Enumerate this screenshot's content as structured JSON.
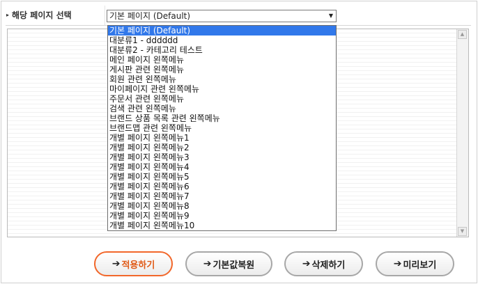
{
  "field": {
    "label": "해당 페이지 선택",
    "selected_value": "기본 페이지 (Default)",
    "options": [
      "기본 페이지 (Default)",
      "대분류1 - dddddd",
      "대분류2 - 카테고리 테스트",
      "메인 페이지 왼쪽메뉴",
      "게시판 관련 왼쪽메뉴",
      "회원 관련 왼쪽메뉴",
      "마이페이지 관련 왼쪽메뉴",
      "주문서 관련 왼쪽메뉴",
      "검색 관련 왼쪽메뉴",
      "브랜드 상품 목록 관련 왼쪽메뉴",
      "브랜드맵 관련 왼쪽메뉴",
      "개별 페이지 왼쪽메뉴1",
      "개별 페이지 왼쪽메뉴2",
      "개별 페이지 왼쪽메뉴3",
      "개별 페이지 왼쪽메뉴4",
      "개별 페이지 왼쪽메뉴5",
      "개별 페이지 왼쪽메뉴6",
      "개별 페이지 왼쪽메뉴7",
      "개별 페이지 왼쪽메뉴8",
      "개별 페이지 왼쪽메뉴9",
      "개별 페이지 왼쪽메뉴10"
    ]
  },
  "buttons": {
    "apply": "적용하기",
    "restore": "기본값복원",
    "delete": "삭제하기",
    "preview": "미리보기"
  },
  "colors": {
    "accent": "#f2672a",
    "highlight": "#3178ea",
    "border": "#a7a7a7"
  }
}
